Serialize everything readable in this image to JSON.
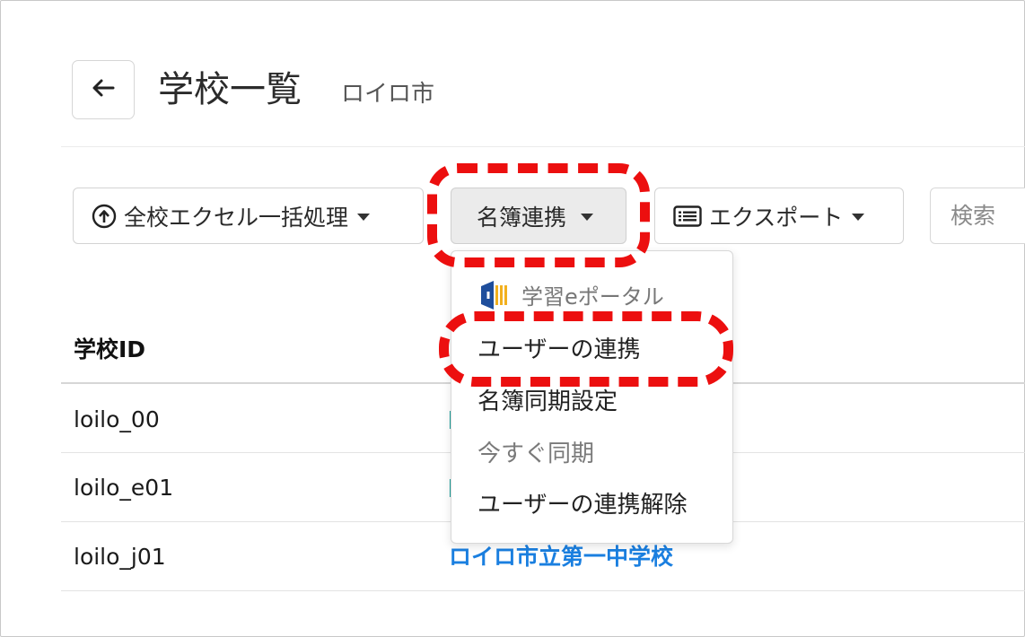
{
  "header": {
    "back_label": "←",
    "title": "学校一覧",
    "subtitle": "ロイロ市"
  },
  "toolbar": {
    "bulk_label": "全校エクセル一括処理",
    "roster_label": "名簿連携",
    "export_label": "エクスポート",
    "search_placeholder": "検索"
  },
  "table": {
    "col_id_header": "学校ID",
    "rows": [
      {
        "id": "loilo_00",
        "name": ""
      },
      {
        "id": "loilo_e01",
        "name": ""
      },
      {
        "id": "loilo_j01",
        "name": "ロイロ市立第一中学校"
      }
    ]
  },
  "dropdown": {
    "header": "学習eポータル",
    "items": [
      {
        "label": "ユーザーの連携",
        "enabled": true
      },
      {
        "label": "名簿同期設定",
        "enabled": true
      },
      {
        "label": "今すぐ同期",
        "enabled": false
      },
      {
        "label": "ユーザーの連携解除",
        "enabled": true
      }
    ]
  },
  "colors": {
    "highlight": "#ec0f0f",
    "link": "#1a7fe0",
    "portal_blue": "#1f4e9c",
    "portal_yellow": "#f2b01e"
  },
  "icons": {
    "back": "arrow-left-icon",
    "bulk": "upload-circle-icon",
    "export": "list-icon",
    "portal": "portal-logo-icon"
  }
}
